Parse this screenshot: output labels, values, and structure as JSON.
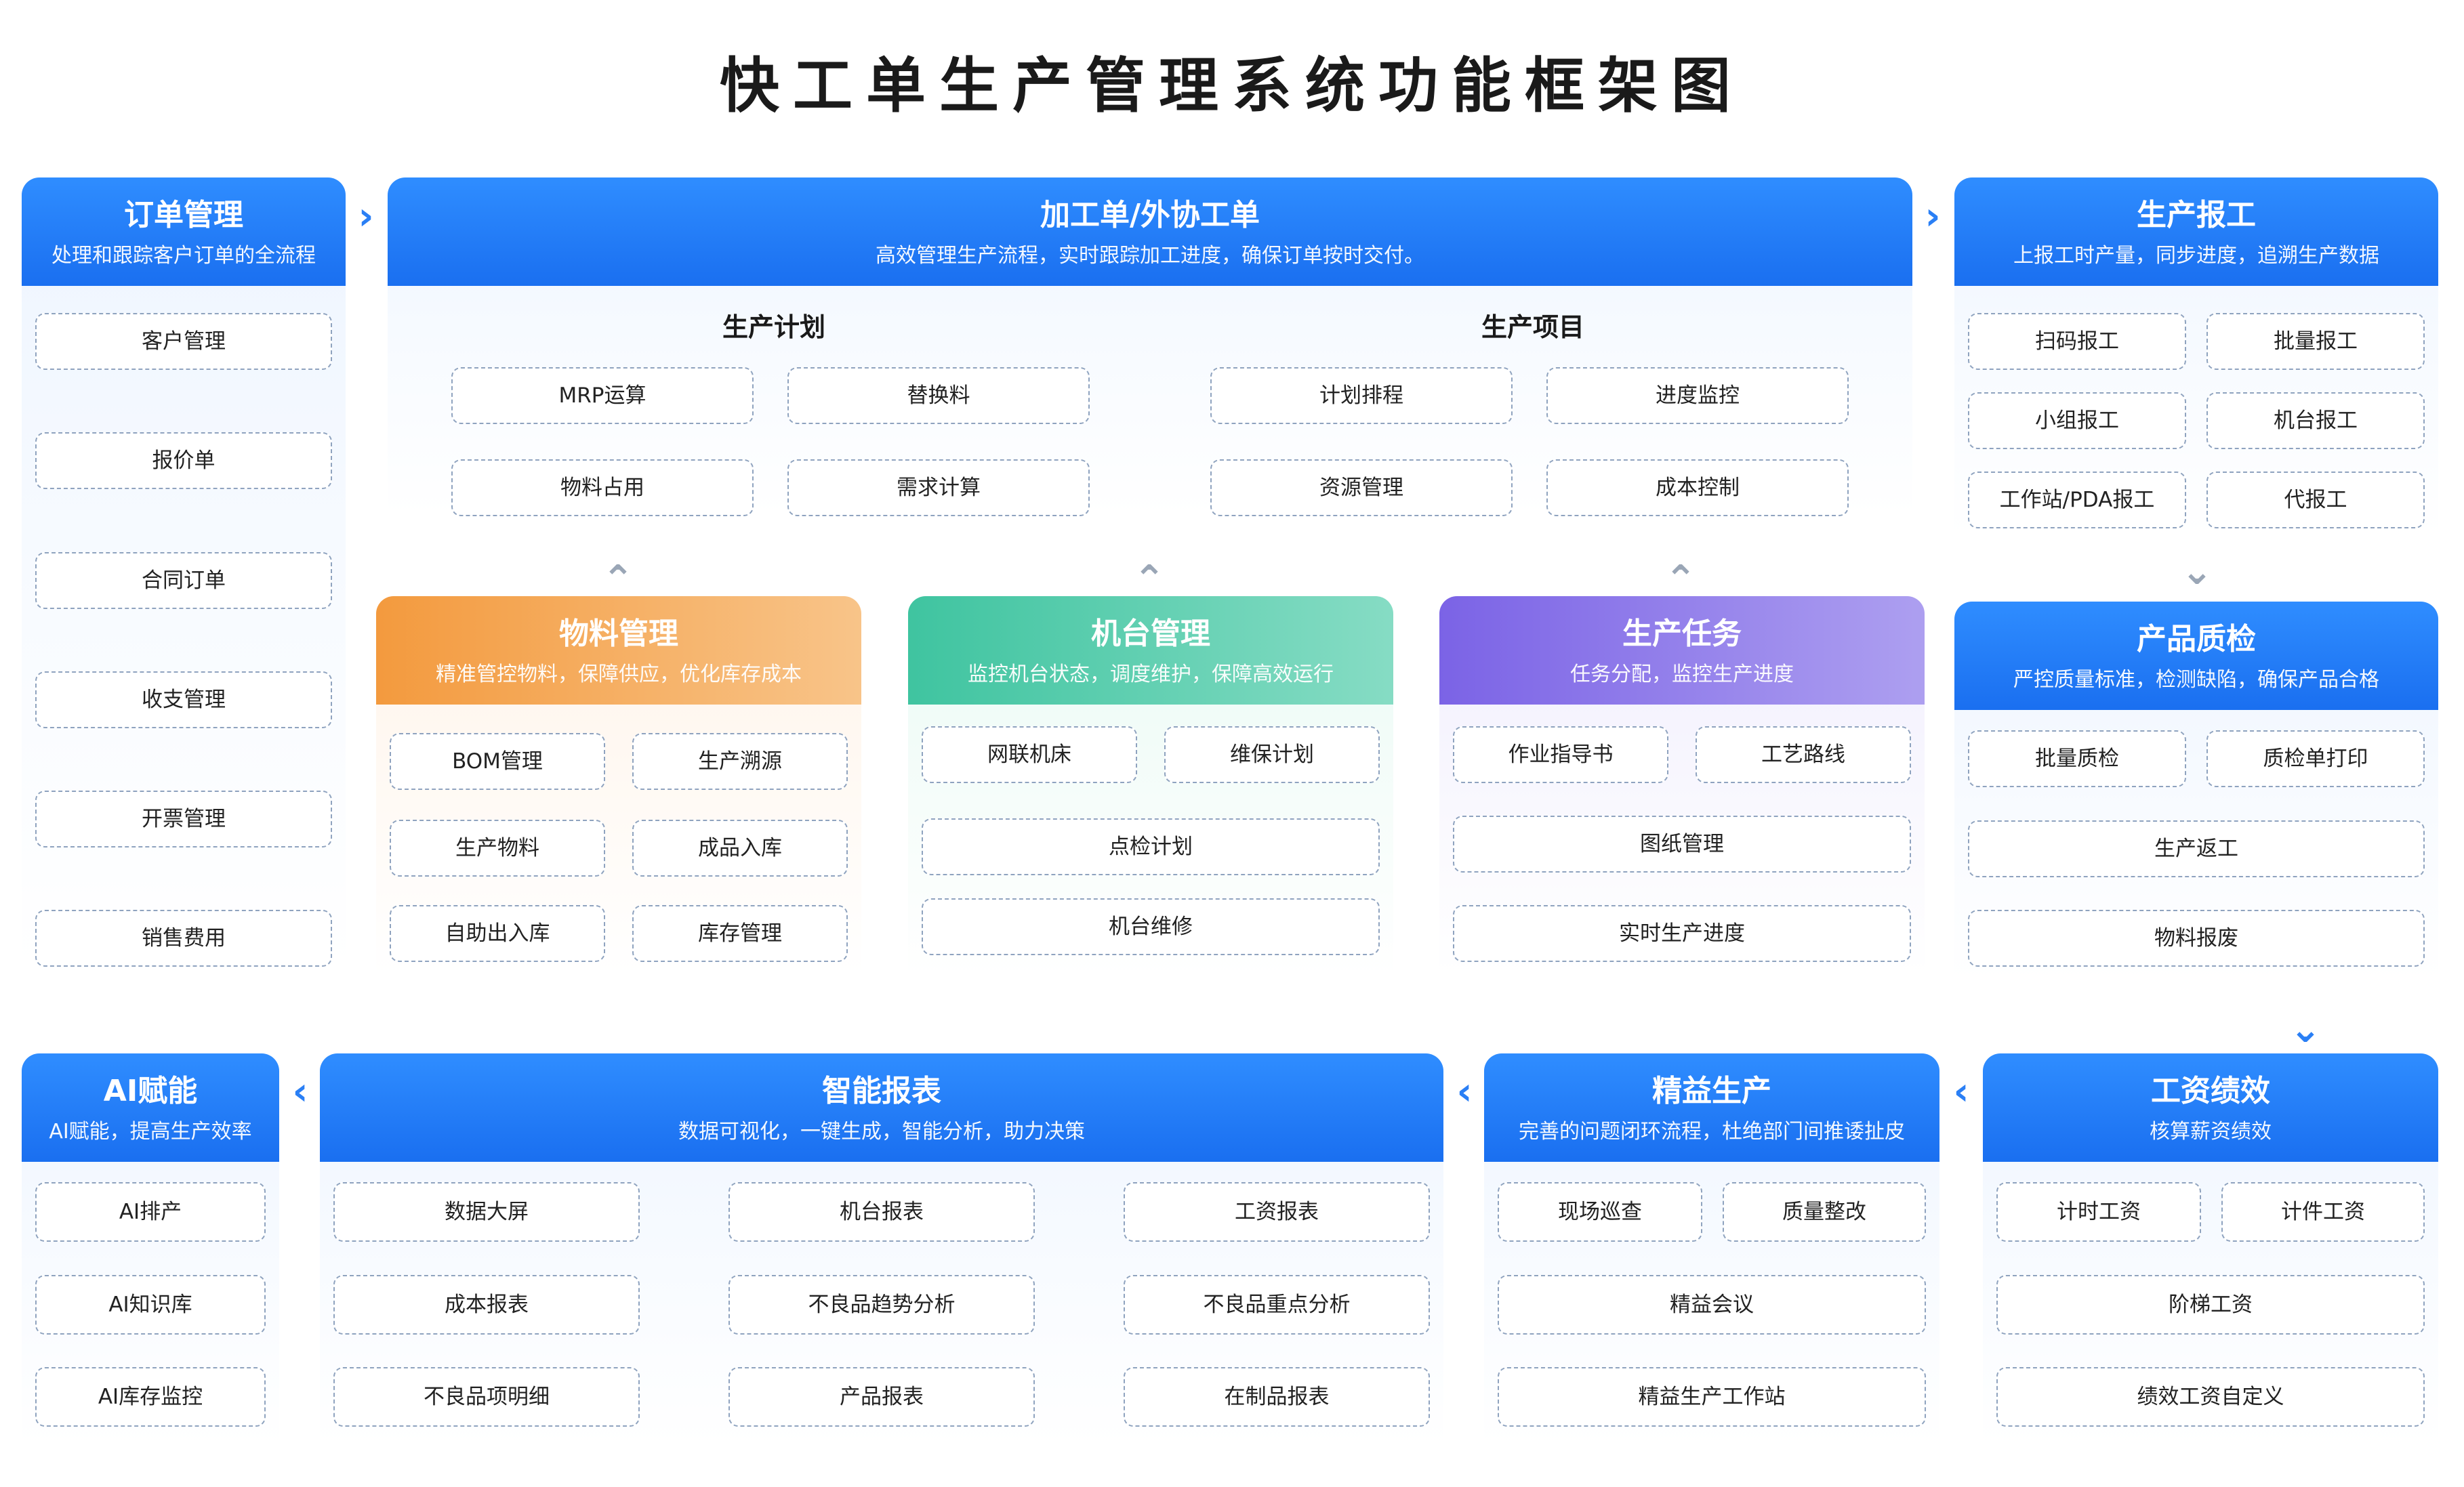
{
  "title": "快工单生产管理系统功能框架图",
  "arrows": {
    "right": "›",
    "left": "‹",
    "down": "⌄",
    "up": "⌃"
  },
  "colors": {
    "blue": "#1a6ff0",
    "orange": "#f39a3e",
    "green": "#3fc4a0",
    "purple": "#7b63e6"
  },
  "order": {
    "title": "订单管理",
    "sub": "处理和跟踪客户订单的全流程",
    "items": [
      "客户管理",
      "报价单",
      "合同订单",
      "收支管理",
      "开票管理",
      "销售费用"
    ]
  },
  "processing": {
    "title": "加工单/外协工单",
    "sub": "高效管理生产流程，实时跟踪加工进度，确保订单按时交付。",
    "plan": {
      "title": "生产计划",
      "items": [
        "MRP运算",
        "替换料",
        "物料占用",
        "需求计算"
      ]
    },
    "project": {
      "title": "生产项目",
      "items": [
        "计划排程",
        "进度监控",
        "资源管理",
        "成本控制"
      ]
    }
  },
  "report": {
    "title": "生产报工",
    "sub": "上报工时产量，同步进度，追溯生产数据",
    "items": [
      "扫码报工",
      "批量报工",
      "小组报工",
      "机台报工",
      "工作站/PDA报工",
      "代报工"
    ]
  },
  "material": {
    "title": "物料管理",
    "sub": "精准管控物料，保障供应，优化库存成本",
    "items": [
      "BOM管理",
      "生产溯源",
      "生产物料",
      "成品入库",
      "自助出入库",
      "库存管理"
    ]
  },
  "machine": {
    "title": "机台管理",
    "sub": "监控机台状态，调度维护，保障高效运行",
    "items": [
      "网联机床",
      "维保计划",
      "点检计划",
      "机台维修"
    ]
  },
  "task": {
    "title": "生产任务",
    "sub": "任务分配，监控生产进度",
    "items": [
      "作业指导书",
      "工艺路线",
      "图纸管理",
      "实时生产进度"
    ]
  },
  "quality": {
    "title": "产品质检",
    "sub": "严控质量标准，检测缺陷，确保产品合格",
    "items": [
      "批量质检",
      "质检单打印",
      "生产返工",
      "物料报废"
    ]
  },
  "ai": {
    "title": "AI赋能",
    "sub": "AI赋能，提高生产效率",
    "items": [
      "AI排产",
      "AI知识库",
      "AI库存监控"
    ]
  },
  "smart": {
    "title": "智能报表",
    "sub": "数据可视化，一键生成，智能分析，助力决策",
    "items": [
      "数据大屏",
      "机台报表",
      "工资报表",
      "成本报表",
      "不良品趋势分析",
      "不良品重点分析",
      "不良品项明细",
      "产品报表",
      "在制品报表"
    ]
  },
  "lean": {
    "title": "精益生产",
    "sub": "完善的问题闭环流程，杜绝部门间推诿扯皮",
    "items": [
      "现场巡查",
      "质量整改",
      "精益会议",
      "精益生产工作站"
    ]
  },
  "wage": {
    "title": "工资绩效",
    "sub": "核算薪资绩效",
    "items": [
      "计时工资",
      "计件工资",
      "阶梯工资",
      "绩效工资自定义"
    ]
  }
}
